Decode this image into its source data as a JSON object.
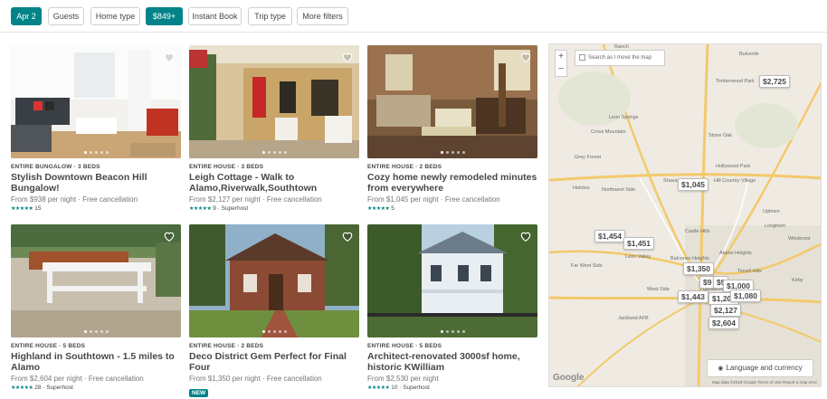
{
  "filters": {
    "date": "Apr 2",
    "guests": "Guests",
    "home_type": "Home type",
    "price": "$849+",
    "instant_book": "Instant Book",
    "trip_type": "Trip type",
    "more_filters": "More filters"
  },
  "listings": [
    {
      "type": "ENTIRE BUNGALOW · 3 BEDS",
      "title": "Stylish Downtown Beacon Hill Bungalow!",
      "price": "From $938 per night · Free cancellation",
      "rating": "15"
    },
    {
      "type": "ENTIRE HOUSE · 3 BEDS",
      "title": "Leigh Cottage - Walk to Alamo,Riverwalk,Southtown",
      "price": "From $2,127 per night · Free cancellation",
      "rating": "9 · Superhost"
    },
    {
      "type": "ENTIRE HOUSE · 2 BEDS",
      "title": "Cozy home newly remodeled minutes from everywhere",
      "price": "From $1,045 per night · Free cancellation",
      "rating": "5"
    },
    {
      "type": "ENTIRE HOUSE · 5 BEDS",
      "title": "Highland in Southtown - 1.5 miles to Alamo",
      "price": "From $2,604 per night · Free cancellation",
      "rating": "28 · Superhost"
    },
    {
      "type": "ENTIRE HOUSE · 2 BEDS",
      "title": "Deco District Gem Perfect for Final Four",
      "price": "From $1,350 per night · Free cancellation",
      "badge": "NEW"
    },
    {
      "type": "ENTIRE HOUSE · 5 BEDS",
      "title": "Architect-renovated 3000sf home, historic KWilliam",
      "price": "From $2,530 per night",
      "rating": "10 · Superhost"
    }
  ],
  "stars": "★★★★★",
  "map": {
    "search_checkbox": "Search as I move the map",
    "zoom_in": "+",
    "zoom_out": "−",
    "language_button": "Language and currency",
    "attribution": "Map data ©2018 Google   Terms of Use   Report a map error",
    "google": "Google",
    "pins": [
      "$2,725",
      "$1,045",
      "$1,454",
      "$1,451",
      "$1,350",
      "$9",
      "$9",
      "$1,000",
      "$1,443",
      "$1,200",
      "$1,080",
      "$2,127",
      "$2,604"
    ],
    "places": [
      "Ranch",
      "Bulverde",
      "Timberwood Park",
      "Leon Springs",
      "Cross Mountain",
      "Grey Forest",
      "Helotes",
      "Shavano",
      "Hill Country Village",
      "Hollywood Park",
      "Castle Hills",
      "Leon Valley",
      "Balcones Heights",
      "Alamo Heights",
      "Terrell Hills",
      "Longhorn",
      "Windcrest",
      "Kirby",
      "Olmos Park",
      "Uptown",
      "Northwest Side",
      "Far West Side",
      "West Side",
      "Jackland AFB",
      "Stone Oak"
    ]
  }
}
